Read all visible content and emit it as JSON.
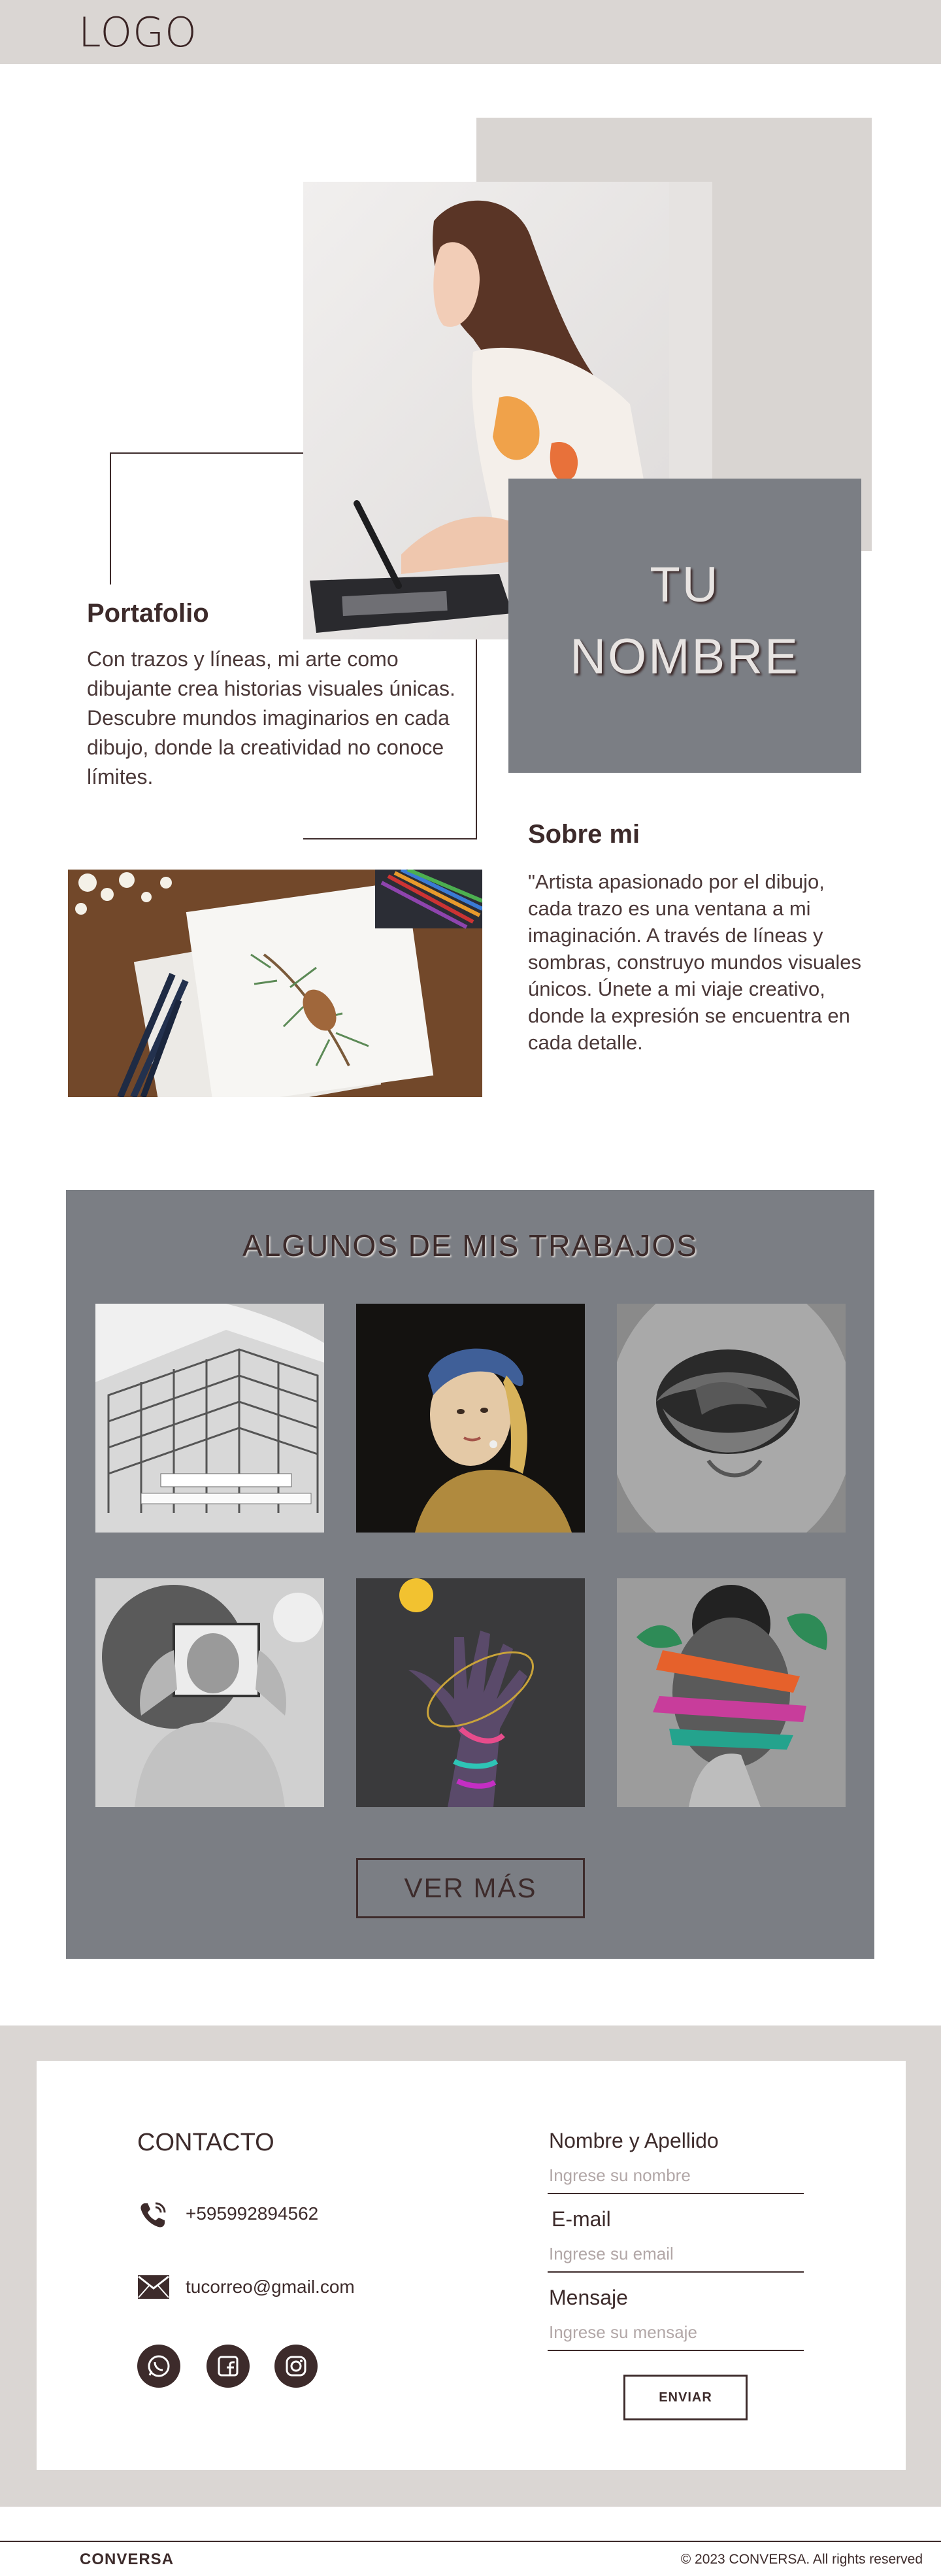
{
  "header": {
    "logo": "LOGO"
  },
  "hero": {
    "name_lines": [
      "TU",
      "NOMBRE"
    ],
    "portfolio_title": "Portafolio",
    "portfolio_text": "Con trazos y líneas, mi arte como dibujante crea historias visuales únicas. Descubre mundos imaginarios en cada dibujo, donde la creatividad no conoce límites."
  },
  "about": {
    "title": "Sobre mi",
    "text": "\"Artista apasionado por el dibujo, cada trazo es una ventana a mi imaginación. A través de líneas y sombras, construyo mundos visuales únicos. Únete a mi viaje creativo, donde la expresión se encuentra en cada detalle."
  },
  "works": {
    "title": "ALGUNOS DE MIS TRABAJOS",
    "items": [
      {
        "icon": "architecture-photo"
      },
      {
        "icon": "girl-with-pearl-earring-painting"
      },
      {
        "icon": "mouth-collage"
      },
      {
        "icon": "man-with-frame-collage"
      },
      {
        "icon": "colorful-hand-art"
      },
      {
        "icon": "face-collage"
      }
    ],
    "button_label": "VER MÁS"
  },
  "contact": {
    "title": "CONTACTO",
    "phone": "+595992894562",
    "email": "tucorreo@gmail.com",
    "social": [
      "whatsapp-icon",
      "facebook-icon",
      "instagram-icon"
    ],
    "form": {
      "name_label": "Nombre y Apellido",
      "name_placeholder": "Ingrese su nombre",
      "email_label": "E-mail",
      "email_placeholder": "Ingrese su email",
      "message_label": "Mensaje",
      "message_placeholder": "Ingrese su mensaje",
      "submit_label": "ENVIAR"
    }
  },
  "footer": {
    "brand": "CONVERSA",
    "copyright": "© 2023 CONVERSA. All rights reserved"
  },
  "colors": {
    "accent_dark": "#3d2b2b",
    "gray_panel": "#7b7e84",
    "light_band": "#dad6d3"
  }
}
